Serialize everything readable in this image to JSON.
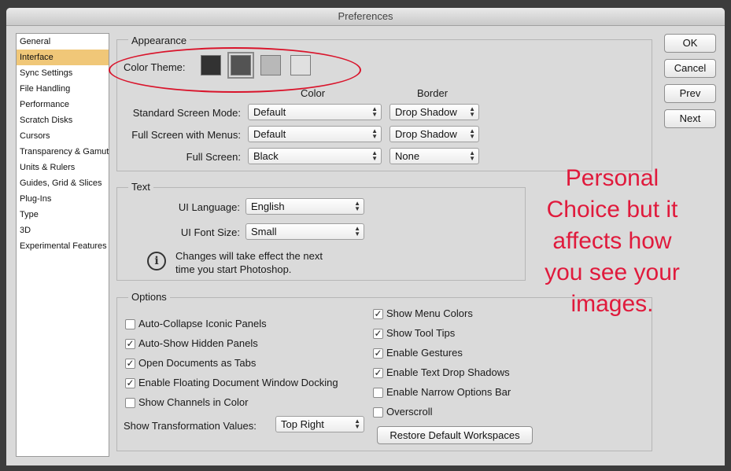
{
  "window": {
    "title": "Preferences"
  },
  "sidebar": {
    "items": [
      {
        "label": "General",
        "selected": false
      },
      {
        "label": "Interface",
        "selected": true
      },
      {
        "label": "Sync Settings",
        "selected": false
      },
      {
        "label": "File Handling",
        "selected": false
      },
      {
        "label": "Performance",
        "selected": false
      },
      {
        "label": "Scratch Disks",
        "selected": false
      },
      {
        "label": "Cursors",
        "selected": false
      },
      {
        "label": "Transparency & Gamut",
        "selected": false
      },
      {
        "label": "Units & Rulers",
        "selected": false
      },
      {
        "label": "Guides, Grid & Slices",
        "selected": false
      },
      {
        "label": "Plug-Ins",
        "selected": false
      },
      {
        "label": "Type",
        "selected": false
      },
      {
        "label": "3D",
        "selected": false
      },
      {
        "label": "Experimental Features",
        "selected": false
      }
    ]
  },
  "appearance": {
    "legend": "Appearance",
    "color_theme_label": "Color Theme:",
    "theme_swatches": [
      "#323232",
      "#535353",
      "#b8b8b8",
      "#e0e0e0"
    ],
    "selected_theme_index": 1,
    "col_color": "Color",
    "col_border": "Border",
    "rows": [
      {
        "label": "Standard Screen Mode:",
        "color": "Default",
        "border": "Drop Shadow"
      },
      {
        "label": "Full Screen with Menus:",
        "color": "Default",
        "border": "Drop Shadow"
      },
      {
        "label": "Full Screen:",
        "color": "Black",
        "border": "None"
      }
    ]
  },
  "text": {
    "legend": "Text",
    "ui_language_label": "UI Language:",
    "ui_language_value": "English",
    "ui_font_size_label": "UI Font Size:",
    "ui_font_size_value": "Small",
    "info_line1": "Changes will take effect the next",
    "info_line2": "time you start Photoshop."
  },
  "options": {
    "legend": "Options",
    "left": [
      {
        "label": "Auto-Collapse Iconic Panels",
        "checked": false
      },
      {
        "label": "Auto-Show Hidden Panels",
        "checked": true
      },
      {
        "label": "Open Documents as Tabs",
        "checked": true
      },
      {
        "label": "Enable Floating Document Window Docking",
        "checked": true
      },
      {
        "label": "Show Channels in Color",
        "checked": false
      }
    ],
    "right": [
      {
        "label": "Show Menu Colors",
        "checked": true
      },
      {
        "label": "Show Tool Tips",
        "checked": true
      },
      {
        "label": "Enable Gestures",
        "checked": true
      },
      {
        "label": "Enable Text Drop Shadows",
        "checked": true
      },
      {
        "label": "Enable Narrow Options Bar",
        "checked": false
      },
      {
        "label": "Overscroll",
        "checked": false
      }
    ],
    "transform_label": "Show Transformation Values:",
    "transform_value": "Top Right",
    "restore_button": "Restore Default Workspaces"
  },
  "buttons": {
    "ok": "OK",
    "cancel": "Cancel",
    "prev": "Prev",
    "next": "Next"
  },
  "annotation": {
    "lines": [
      "Personal",
      "Choice but it",
      "affects how",
      "you see your",
      "images."
    ],
    "color": "#e01a3c"
  },
  "check_mark": "✓",
  "select_arrows": "▲▼"
}
